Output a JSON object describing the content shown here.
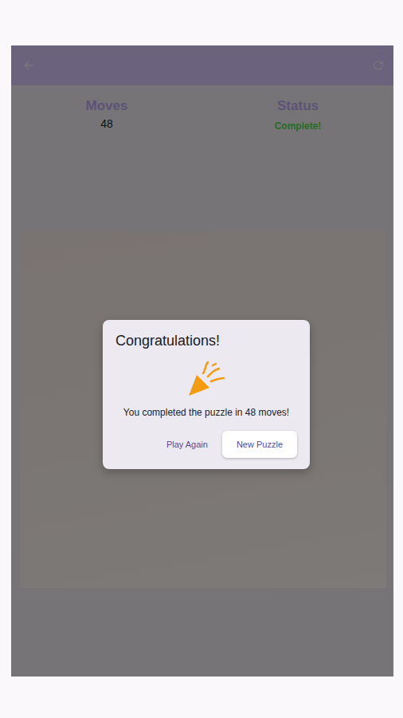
{
  "stats": [
    {
      "label": "Moves",
      "value": "48",
      "kind": "count"
    },
    {
      "label": "Status",
      "value": "Complete!",
      "kind": "status"
    }
  ],
  "dialog": {
    "title": "Congratulations!",
    "message": "You completed the puzzle in 48 moves!",
    "buttons": [
      {
        "label": "Play Again",
        "kind": "text"
      },
      {
        "label": "New Puzzle",
        "kind": "elevated"
      }
    ]
  }
}
